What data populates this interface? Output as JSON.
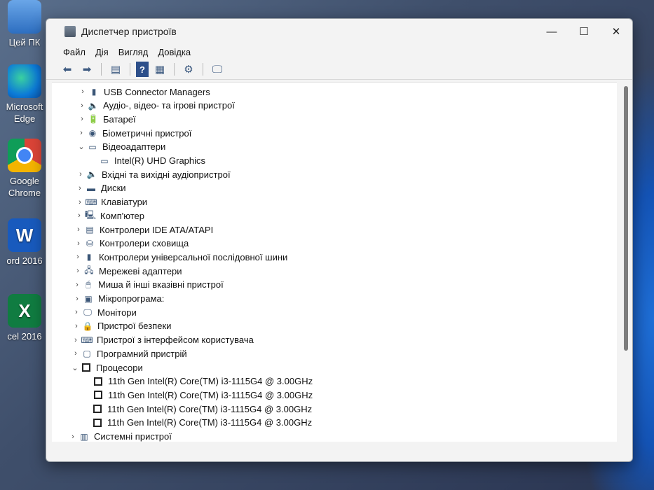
{
  "desktop": {
    "icons": [
      {
        "label": "Цей ПК"
      },
      {
        "label": "Microsoft Edge"
      },
      {
        "label": "Google Chrome"
      },
      {
        "label": "ord 2016"
      },
      {
        "label": "cel 2016"
      }
    ]
  },
  "window": {
    "title": "Диспетчер пристроїв",
    "controls": {
      "minimize": "—",
      "maximize": "☐",
      "close": "✕"
    }
  },
  "menu": [
    "Файл",
    "Дія",
    "Вигляд",
    "Довідка"
  ],
  "toolbar": {
    "buttons": [
      "back-icon",
      "forward-icon",
      "properties-icon",
      "help-icon",
      "view-icon",
      "scan-hardware-icon",
      "monitor-icon"
    ]
  },
  "tree": {
    "items": [
      {
        "label": "USB Connector Managers",
        "expanded": false,
        "icon": "usb-icon"
      },
      {
        "label": "Аудіо-, відео- та ігрові пристрої",
        "expanded": false,
        "icon": "speaker-icon"
      },
      {
        "label": "Батареї",
        "expanded": false,
        "icon": "battery-icon"
      },
      {
        "label": "Біометричні пристрої",
        "expanded": false,
        "icon": "fingerprint-icon"
      },
      {
        "label": "Відеоадаптери",
        "expanded": true,
        "icon": "display-adapter-icon"
      },
      {
        "label": "Intel(R) UHD Graphics",
        "child": true,
        "icon": "display-adapter-icon"
      },
      {
        "label": "Вхідні та вихідні аудіопристрої",
        "expanded": false,
        "icon": "speaker-icon"
      },
      {
        "label": "Диски",
        "expanded": false,
        "icon": "disk-icon"
      },
      {
        "label": "Клавіатури",
        "expanded": false,
        "icon": "keyboard-icon"
      },
      {
        "label": "Комп'ютер",
        "expanded": false,
        "icon": "computer-icon"
      },
      {
        "label": "Контролери IDE ATA/ATAPI",
        "expanded": false,
        "icon": "ide-controller-icon"
      },
      {
        "label": "Контролери сховища",
        "expanded": false,
        "icon": "storage-controller-icon"
      },
      {
        "label": "Контролери універсальної послідовної шини",
        "expanded": false,
        "icon": "usb-icon"
      },
      {
        "label": "Мережеві адаптери",
        "expanded": false,
        "icon": "network-icon"
      },
      {
        "label": "Миша й інші вказівні пристрої",
        "expanded": false,
        "icon": "mouse-icon"
      },
      {
        "label": "Мікропрограма:",
        "expanded": false,
        "icon": "firmware-icon"
      },
      {
        "label": "Монітори",
        "expanded": false,
        "icon": "monitor-icon"
      },
      {
        "label": "Пристрої безпеки",
        "expanded": false,
        "icon": "security-icon"
      },
      {
        "label": "Пристрої з інтерфейсом користувача",
        "expanded": false,
        "icon": "hid-icon"
      },
      {
        "label": "Програмний пристрій",
        "expanded": false,
        "icon": "software-device-icon"
      },
      {
        "label": "Процесори",
        "expanded": true,
        "icon": "cpu-icon"
      },
      {
        "label": "11th Gen Intel(R) Core(TM) i3-1115G4 @ 3.00GHz",
        "child": true,
        "icon": "cpu-icon"
      },
      {
        "label": "11th Gen Intel(R) Core(TM) i3-1115G4 @ 3.00GHz",
        "child": true,
        "icon": "cpu-icon"
      },
      {
        "label": "11th Gen Intel(R) Core(TM) i3-1115G4 @ 3.00GHz",
        "child": true,
        "icon": "cpu-icon"
      },
      {
        "label": "11th Gen Intel(R) Core(TM) i3-1115G4 @ 3.00GHz",
        "child": true,
        "icon": "cpu-icon"
      },
      {
        "label": "Системні пристрої",
        "expanded": false,
        "icon": "system-icon"
      }
    ]
  }
}
